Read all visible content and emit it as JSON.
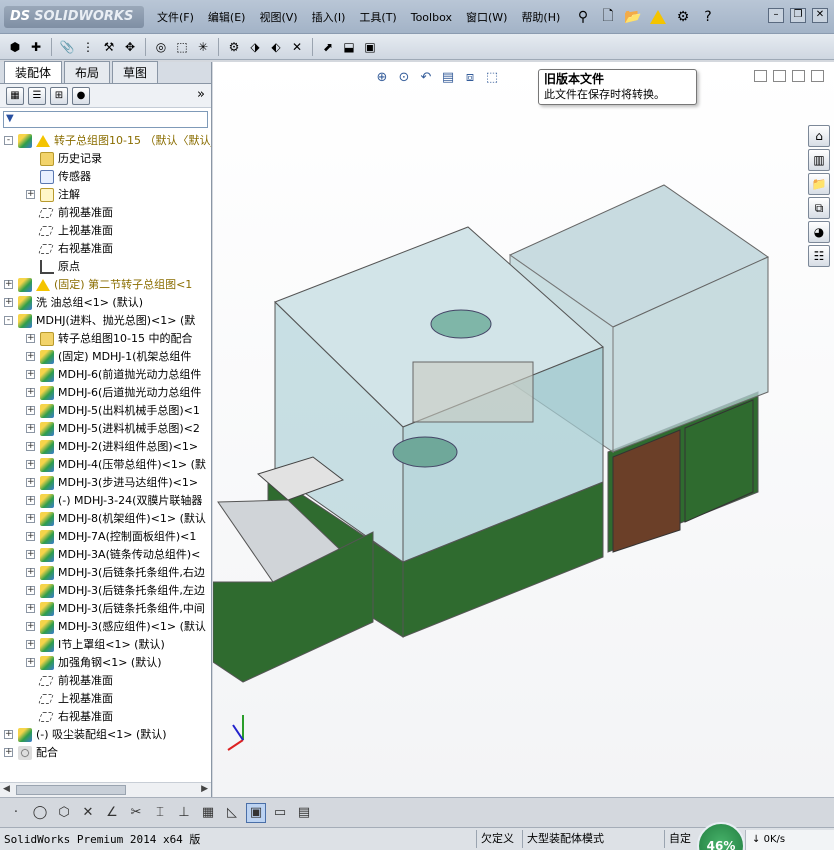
{
  "app": {
    "brand": "SOLIDWORKS",
    "brand_mark": "DS"
  },
  "menu": [
    "文件(F)",
    "编辑(E)",
    "视图(V)",
    "插入(I)",
    "工具(T)",
    "Toolbox",
    "窗口(W)",
    "帮助(H)"
  ],
  "tabs": [
    "装配体",
    "布局",
    "草图"
  ],
  "tree": [
    {
      "label": "转子总组图10-15 （默认〈默认_",
      "icon": "asm",
      "warn": true,
      "gold": true,
      "level": 0,
      "expand": "-"
    },
    {
      "label": "历史记录",
      "icon": "folder",
      "level": 1,
      "expand": ""
    },
    {
      "label": "传感器",
      "icon": "sensor",
      "level": 1,
      "expand": ""
    },
    {
      "label": "注解",
      "icon": "annot",
      "level": 1,
      "expand": "+"
    },
    {
      "label": "前视基准面",
      "icon": "plane",
      "level": 1,
      "expand": ""
    },
    {
      "label": "上视基准面",
      "icon": "plane",
      "level": 1,
      "expand": ""
    },
    {
      "label": "右视基准面",
      "icon": "plane",
      "level": 1,
      "expand": ""
    },
    {
      "label": "原点",
      "icon": "origin",
      "level": 1,
      "expand": ""
    },
    {
      "label": "(固定) 第二节转子总组图<1",
      "icon": "asm",
      "warn": true,
      "gold": true,
      "level": 0,
      "expand": "+"
    },
    {
      "label": "洗  油总组<1> (默认)",
      "icon": "asm",
      "level": 0,
      "expand": "+"
    },
    {
      "label": "MDHJ(进料、抛光总图)<1> (默",
      "icon": "asm",
      "level": 0,
      "expand": "-"
    },
    {
      "label": "转子总组图10-15 中的配合",
      "icon": "folder",
      "level": 1,
      "expand": "+"
    },
    {
      "label": "(固定) MDHJ-1(机架总组件",
      "icon": "asm",
      "level": 1,
      "expand": "+"
    },
    {
      "label": "MDHJ-6(前道抛光动力总组件",
      "icon": "asm",
      "level": 1,
      "expand": "+"
    },
    {
      "label": "MDHJ-6(后道抛光动力总组件",
      "icon": "asm",
      "level": 1,
      "expand": "+"
    },
    {
      "label": "MDHJ-5(出料机械手总图)<1",
      "icon": "asm",
      "level": 1,
      "expand": "+"
    },
    {
      "label": "MDHJ-5(进料机械手总图)<2",
      "icon": "asm",
      "level": 1,
      "expand": "+"
    },
    {
      "label": "MDHJ-2(进料组件总图)<1>",
      "icon": "asm",
      "level": 1,
      "expand": "+"
    },
    {
      "label": "MDHJ-4(压带总组件)<1> (默",
      "icon": "asm",
      "level": 1,
      "expand": "+"
    },
    {
      "label": "MDHJ-3(步进马达组件)<1>",
      "icon": "asm",
      "level": 1,
      "expand": "+"
    },
    {
      "label": "(-) MDHJ-3-24(双膜片联轴器",
      "icon": "asm",
      "level": 1,
      "expand": "+"
    },
    {
      "label": "MDHJ-8(机架组件)<1> (默认",
      "icon": "asm",
      "level": 1,
      "expand": "+"
    },
    {
      "label": "MDHJ-7A(控制面板组件)<1",
      "icon": "asm",
      "level": 1,
      "expand": "+"
    },
    {
      "label": "MDHJ-3A(链条传动总组件)<",
      "icon": "asm",
      "level": 1,
      "expand": "+"
    },
    {
      "label": "MDHJ-3(后链条托条组件,右边",
      "icon": "asm",
      "level": 1,
      "expand": "+"
    },
    {
      "label": "MDHJ-3(后链条托条组件,左边",
      "icon": "asm",
      "level": 1,
      "expand": "+"
    },
    {
      "label": "MDHJ-3(后链条托条组件,中间",
      "icon": "asm",
      "level": 1,
      "expand": "+"
    },
    {
      "label": "MDHJ-3(感应组件)<1> (默认",
      "icon": "asm",
      "level": 1,
      "expand": "+"
    },
    {
      "label": "I节上罩组<1> (默认)",
      "icon": "asm",
      "level": 1,
      "expand": "+"
    },
    {
      "label": "加强角钢<1> (默认)",
      "icon": "asm",
      "level": 1,
      "expand": "+"
    },
    {
      "label": "前视基准面",
      "icon": "plane",
      "level": 1,
      "expand": ""
    },
    {
      "label": "上视基准面",
      "icon": "plane",
      "level": 1,
      "expand": ""
    },
    {
      "label": "右视基准面",
      "icon": "plane",
      "level": 1,
      "expand": ""
    },
    {
      "label": "(-) 吸尘装配组<1> (默认)",
      "icon": "asm",
      "level": 0,
      "expand": "+"
    },
    {
      "label": "配合",
      "icon": "mate",
      "level": 0,
      "expand": "+"
    }
  ],
  "tooltip": {
    "title": "旧版本文件",
    "body": "此文件在保存时将转换。"
  },
  "status": {
    "app_version": "SolidWorks Premium 2014 x64 版",
    "underdefined": "欠定义",
    "large_mode": "大型装配体模式",
    "custom": "自定"
  },
  "network": {
    "percent": "46%",
    "speed": "0K/s"
  },
  "colors": {
    "cabinet_green": "#2f6b2f",
    "frame_gray": "#b8bcc2",
    "glass": "#9fc9cf",
    "door_brown": "#6b3f28"
  }
}
